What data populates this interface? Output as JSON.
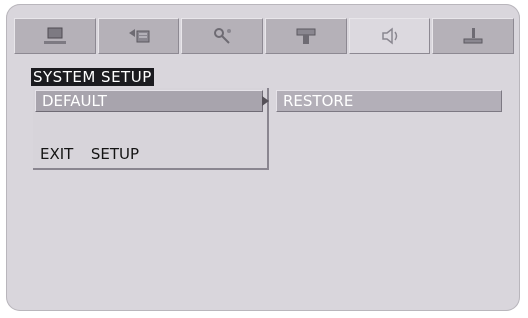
{
  "tabs": [
    {
      "icon": "monitor-icon",
      "active": false
    },
    {
      "icon": "language-icon",
      "active": false
    },
    {
      "icon": "video-settings-icon",
      "active": false
    },
    {
      "icon": "speaker-setup-icon",
      "active": false
    },
    {
      "icon": "audio-volume-icon",
      "active": true
    },
    {
      "icon": "system-icon",
      "active": false
    }
  ],
  "menu": {
    "title": "SYSTEM SETUP",
    "items": [
      {
        "label": "DEFAULT",
        "selected": true
      },
      {
        "label": "EXIT  SETUP",
        "selected": false
      }
    ],
    "submenu": {
      "items": [
        {
          "label": "RESTORE"
        }
      ]
    }
  },
  "colors": {
    "background": "#d9d6dc",
    "tab": "#b5b1b8",
    "highlight": "#a8a4ad",
    "title_bg": "#1b1b1f"
  }
}
